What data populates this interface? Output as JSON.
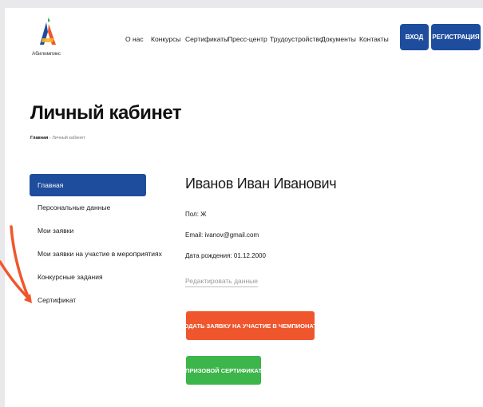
{
  "header": {
    "logo_text": "Абилимпикс",
    "nav": [
      "О нас",
      "Конкурсы",
      "Сертификаты",
      "Пресс-центр",
      "Трудоустройство",
      "Документы",
      "Контакты"
    ],
    "login_label": "ВХОД",
    "register_label": "РЕГИСТРАЦИЯ"
  },
  "page": {
    "title": "Личный кабинет",
    "breadcrumb_home": "Главная",
    "breadcrumb_sep": " › ",
    "breadcrumb_current": "Личный кабинет"
  },
  "sidebar": {
    "items": [
      {
        "label": "Главная",
        "active": true
      },
      {
        "label": "Персональные данные",
        "active": false
      },
      {
        "label": "Мои заявки",
        "active": false
      },
      {
        "label": "Мои заявки на участие в мероприятиях",
        "active": false
      },
      {
        "label": "Конкурсные задания",
        "active": false
      },
      {
        "label": "Сертификат",
        "active": false
      }
    ]
  },
  "profile": {
    "name": "Иванов Иван Иванович",
    "gender": "Пол: Ж",
    "email": "Email: ivanov@gmail.com",
    "birthdate": "Дата рождения: 01.12.2000",
    "edit_label": "Редактировать данные",
    "apply_label": "ПОДАТЬ ЗАЯВКУ НА УЧАСТИЕ В ЧЕМПИОНАТЕ",
    "certificate_label": "ПРИЗОВОЙ СЕРТИФИКАТ"
  },
  "colors": {
    "primary": "#1f4d9e",
    "accent_orange": "#f0562d",
    "accent_green": "#3cb54a",
    "annotation": "#f0562d"
  }
}
